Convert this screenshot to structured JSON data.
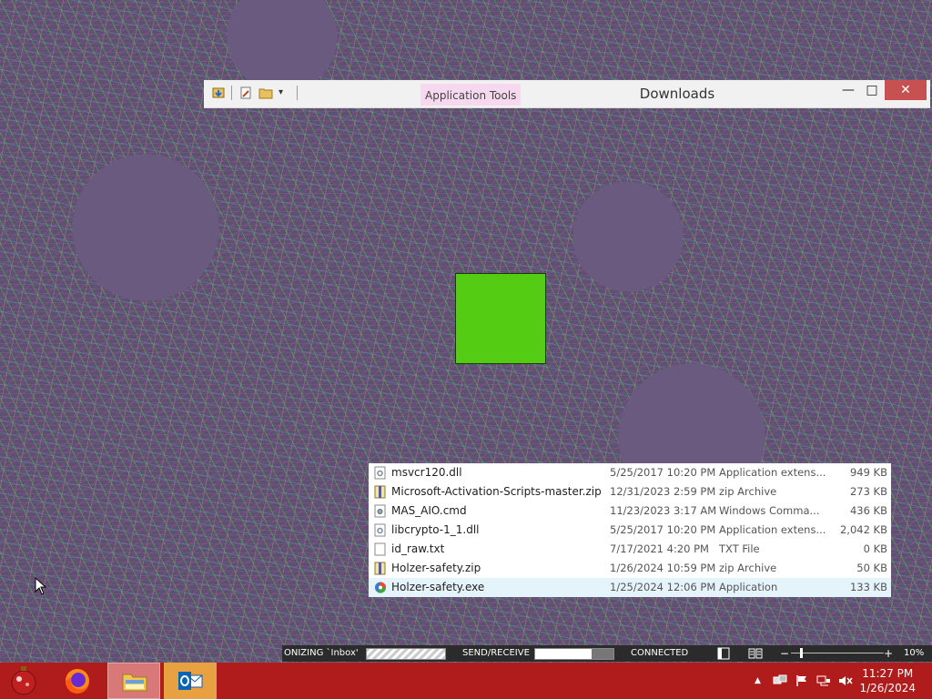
{
  "window": {
    "title": "Downloads",
    "context_tab": "Application Tools",
    "minimize_glyph": "—",
    "maximize_glyph": "□",
    "close_glyph": "✕"
  },
  "files": [
    {
      "name": "msvcr120.dll",
      "date": "5/25/2017 10:20 PM",
      "type": "Application extens...",
      "size": "949 KB",
      "icon": "dll-file-icon"
    },
    {
      "name": "Microsoft-Activation-Scripts-master.zip",
      "date": "12/31/2023 2:59 PM",
      "type": "zip Archive",
      "size": "273 KB",
      "icon": "zip-file-icon"
    },
    {
      "name": "MAS_AIO.cmd",
      "date": "11/23/2023 3:17 AM",
      "type": "Windows Comma...",
      "size": "436 KB",
      "icon": "cmd-file-icon"
    },
    {
      "name": "libcrypto-1_1.dll",
      "date": "5/25/2017 10:20 PM",
      "type": "Application extens...",
      "size": "2,042 KB",
      "icon": "dll-file-icon"
    },
    {
      "name": "id_raw.txt",
      "date": "7/17/2021 4:20 PM",
      "type": "TXT File",
      "size": "0 KB",
      "icon": "txt-file-icon"
    },
    {
      "name": "Holzer-safety.zip",
      "date": "1/26/2024 10:59 PM",
      "type": "zip Archive",
      "size": "50 KB",
      "icon": "zip-file-icon"
    },
    {
      "name": "Holzer-safety.exe",
      "date": "1/25/2024 12:06 PM",
      "type": "Application",
      "size": "133 KB",
      "icon": "exe-app-icon"
    }
  ],
  "outlook_status": {
    "sync_text": "ONIZING `Inbox'",
    "send_receive": "SEND/RECEIVE",
    "send_receive_progress": 0.72,
    "connection": "CONNECTED",
    "zoom": "10%",
    "zoom_level": 0.1
  },
  "taskbar": {
    "apps": [
      "start-orb-icon",
      "firefox-icon",
      "file-explorer-icon",
      "outlook-icon"
    ],
    "clock_time": "11:27 PM",
    "clock_date": "1/26/2024"
  },
  "colors": {
    "taskbar": "#b01c1c",
    "green_square": "#55cc14",
    "context_tab": "#f6d8ef",
    "selection": "#e5f3fb"
  }
}
